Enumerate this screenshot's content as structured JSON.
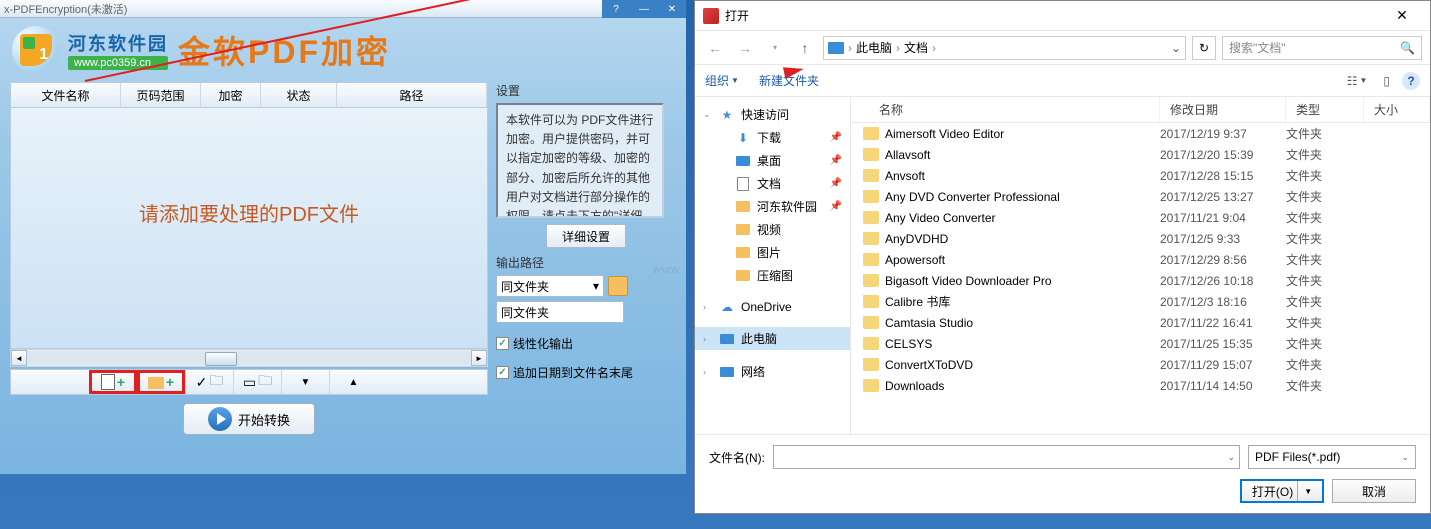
{
  "app": {
    "title": "x-PDFEncryption(未激活)",
    "brand_cn": "河东软件园",
    "brand_url": "www.pc0359.cn",
    "app_name": "金软PDF加密"
  },
  "table": {
    "headers": [
      "文件名称",
      "页码范围",
      "加密",
      "状态",
      "路径"
    ],
    "empty_text": "请添加要处理的PDF文件"
  },
  "settings": {
    "label": "设置",
    "text": "    本软件可以为 PDF文件进行加密。用户提供密码，并可以指定加密的等级、加密的部分、加密后所允许的其他用户对文档进行部分操作的权限。请点击下方的\"详细设置\"按钮进行详细的设置。",
    "detail_btn": "详细设置"
  },
  "output": {
    "label": "输出路径",
    "select_value": "同文件夹",
    "input_value": "同文件夹",
    "check1": "线性化输出",
    "check2": "追加日期到文件名末尾"
  },
  "start_btn": "开始转换",
  "dialog": {
    "title": "打开",
    "breadcrumb": {
      "pc": "此电脑",
      "docs": "文档"
    },
    "search_placeholder": "搜索\"文档\"",
    "organize": "组织",
    "new_folder": "新建文件夹",
    "columns": [
      "名称",
      "修改日期",
      "类型",
      "大小"
    ],
    "sidebar": {
      "quick": "快速访问",
      "downloads": "下载",
      "desktop": "桌面",
      "documents": "文档",
      "hedong": "河东软件园",
      "video": "视频",
      "pictures": "图片",
      "compressed": "压缩图",
      "onedrive": "OneDrive",
      "thispc": "此电脑",
      "network": "网络"
    },
    "files": [
      {
        "name": "Aimersoft Video Editor",
        "date": "2017/12/19 9:37",
        "type": "文件夹"
      },
      {
        "name": "Allavsoft",
        "date": "2017/12/20 15:39",
        "type": "文件夹"
      },
      {
        "name": "Anvsoft",
        "date": "2017/12/28 15:15",
        "type": "文件夹"
      },
      {
        "name": "Any DVD Converter Professional",
        "date": "2017/12/25 13:27",
        "type": "文件夹"
      },
      {
        "name": "Any Video Converter",
        "date": "2017/11/21 9:04",
        "type": "文件夹"
      },
      {
        "name": "AnyDVDHD",
        "date": "2017/12/5 9:33",
        "type": "文件夹"
      },
      {
        "name": "Apowersoft",
        "date": "2017/12/29 8:56",
        "type": "文件夹"
      },
      {
        "name": "Bigasoft Video Downloader Pro",
        "date": "2017/12/26 10:18",
        "type": "文件夹"
      },
      {
        "name": "Calibre 书库",
        "date": "2017/12/3 18:16",
        "type": "文件夹"
      },
      {
        "name": "Camtasia Studio",
        "date": "2017/11/22 16:41",
        "type": "文件夹"
      },
      {
        "name": "CELSYS",
        "date": "2017/11/25 15:35",
        "type": "文件夹"
      },
      {
        "name": "ConvertXToDVD",
        "date": "2017/11/29 15:07",
        "type": "文件夹"
      },
      {
        "name": "Downloads",
        "date": "2017/11/14 14:50",
        "type": "文件夹"
      }
    ],
    "filename_label": "文件名(N):",
    "filter": "PDF Files(*.pdf)",
    "open_btn": "打开(O)",
    "cancel_btn": "取消"
  }
}
